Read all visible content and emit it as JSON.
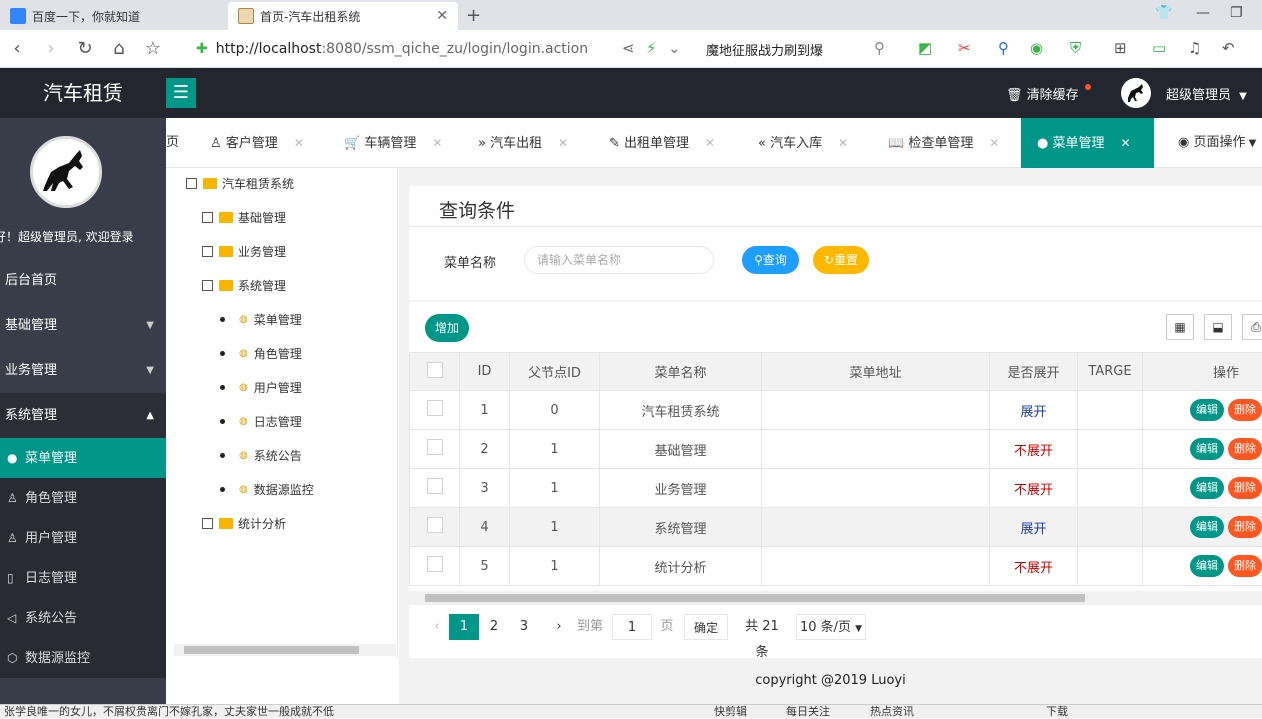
{
  "browser": {
    "tabs": [
      {
        "title": "百度一下，你就知道"
      },
      {
        "title": "首页-汽车出租系统"
      }
    ],
    "new_tab": "+",
    "url_host": "http://localhost",
    "url_rest": ":8080/ssm_qiche_zu/login/login.action",
    "hot_search": "魔地征服战力刷到爆"
  },
  "app": {
    "logo": "汽车租赁",
    "menu_icon": "☰",
    "clear_cache": "清除缓存",
    "admin_name": "超级管理员"
  },
  "sidebar": {
    "welcome": "好！超级管理员, 欢迎登录",
    "nav": [
      {
        "label": "后台首页"
      },
      {
        "label": "基础管理"
      },
      {
        "label": "业务管理"
      },
      {
        "label": "系统管理"
      }
    ],
    "sub": [
      {
        "label": "菜单管理"
      },
      {
        "label": "角色管理"
      },
      {
        "label": "用户管理"
      },
      {
        "label": "日志管理"
      },
      {
        "label": "系统公告"
      },
      {
        "label": "数据源监控"
      }
    ]
  },
  "content_tabs": [
    {
      "label": "页"
    },
    {
      "label": "客户管理"
    },
    {
      "label": "车辆管理"
    },
    {
      "label": "汽车出租"
    },
    {
      "label": "出租单管理"
    },
    {
      "label": "汽车入库"
    },
    {
      "label": "检查单管理"
    },
    {
      "label": "菜单管理"
    },
    {
      "label": "页面操作"
    }
  ],
  "tree": {
    "root": "汽车租赁系统",
    "groups": [
      "基础管理",
      "业务管理",
      "系统管理",
      "统计分析"
    ],
    "leaves": [
      "菜单管理",
      "角色管理",
      "用户管理",
      "日志管理",
      "系统公告",
      "数据源监控"
    ]
  },
  "query": {
    "title": "查询条件",
    "label": "菜单名称",
    "placeholder": "请输入菜单名称",
    "search_btn": "查询",
    "reset_btn": "重置"
  },
  "table": {
    "add_btn": "增加",
    "headers": [
      "ID",
      "父节点ID",
      "菜单名称",
      "菜单地址",
      "是否展开",
      "TARGE",
      "操作"
    ],
    "rows": [
      {
        "id": "1",
        "pid": "0",
        "name": "汽车租赁系统",
        "url": "",
        "open": "展开",
        "target": ""
      },
      {
        "id": "2",
        "pid": "1",
        "name": "基础管理",
        "url": "",
        "open": "不展开",
        "target": ""
      },
      {
        "id": "3",
        "pid": "1",
        "name": "业务管理",
        "url": "",
        "open": "不展开",
        "target": ""
      },
      {
        "id": "4",
        "pid": "1",
        "name": "系统管理",
        "url": "",
        "open": "展开",
        "target": ""
      },
      {
        "id": "5",
        "pid": "1",
        "name": "统计分析",
        "url": "",
        "open": "不展开",
        "target": ""
      }
    ],
    "edit_label": "编辑",
    "delete_label": "删除"
  },
  "pager": {
    "pages": [
      "1",
      "2",
      "3"
    ],
    "goto_label": "到第",
    "goto_value": "1",
    "page_unit": "页",
    "confirm": "确定",
    "total": "共 21 条",
    "page_size": "10 条/页"
  },
  "footer": "copyright @2019 Luoyi",
  "statusbar": {
    "left": "张学良唯一的女儿，不屑权贵离门不嫁孔家，丈夫家世一般成就不低",
    "items": [
      "快剪辑",
      "每日关注",
      "热点资讯",
      "下载"
    ]
  },
  "colors": {
    "accent": "#009688",
    "header": "#23262e",
    "sidebar": "#393d49",
    "warn": "#ff5722",
    "info": "#1e9fff",
    "yellow": "#ffb800"
  }
}
